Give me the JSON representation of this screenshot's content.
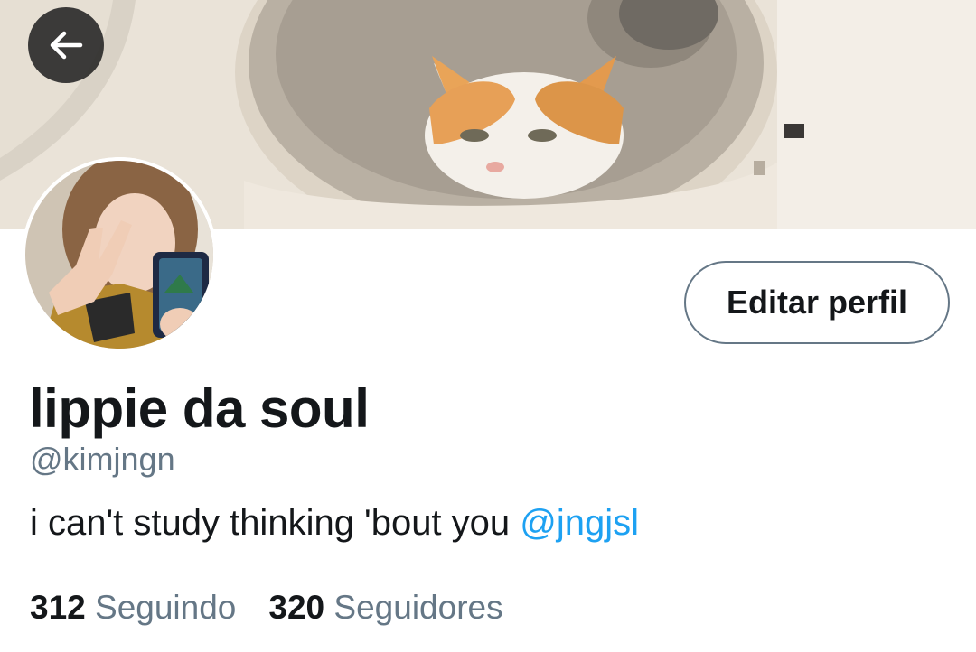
{
  "header": {
    "back_icon": "arrow-left-icon"
  },
  "profile": {
    "edit_button_label": "Editar perfil",
    "display_name": "lippie da soul",
    "handle": "@kimjngn",
    "bio_text": "i can't study thinking 'bout you ",
    "bio_mention": "@jngjsl",
    "following_count": "312",
    "following_label": "Seguindo",
    "followers_count": "320",
    "followers_label": "Seguidores"
  },
  "colors": {
    "text_primary": "#14171a",
    "text_secondary": "#657786",
    "link": "#1da1f2",
    "back_button_bg": "#232323"
  }
}
